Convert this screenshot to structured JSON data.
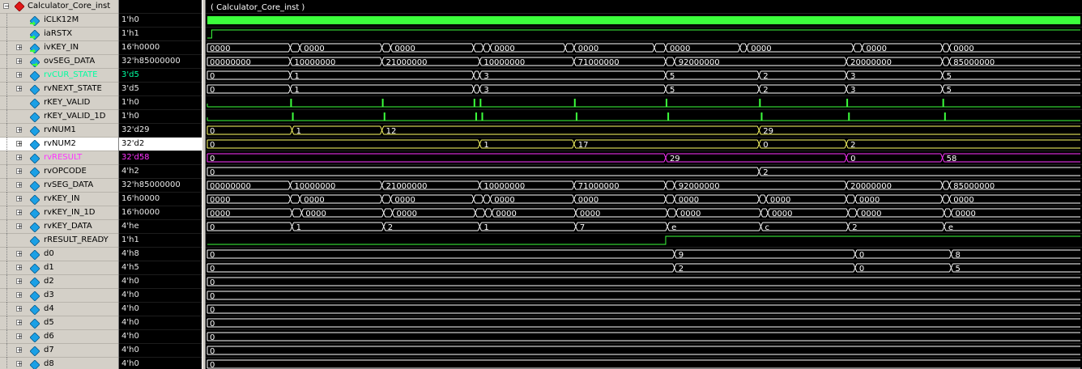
{
  "root": {
    "name": "Calculator_Core_inst",
    "wave_label": "( Calculator_Core_inst )"
  },
  "signals": [
    {
      "id": "iCLK12M",
      "name": "iCLK12M",
      "value": "1'h0",
      "kind": "clock",
      "color": "#3cff3c",
      "expandable": false,
      "icon": "input-icon"
    },
    {
      "id": "iaRSTX",
      "name": "iaRSTX",
      "value": "1'h1",
      "kind": "bit",
      "color": "#3cff3c",
      "expandable": false,
      "icon": "input-icon",
      "transitions": [
        [
          0.005,
          1
        ]
      ]
    },
    {
      "id": "ivKEY_IN",
      "name": "ivKEY_IN",
      "value": "16'h0000",
      "kind": "bus",
      "color": "#ffffff",
      "expandable": true,
      "icon": "input-icon",
      "segments": [
        [
          0,
          "0000"
        ],
        [
          0.095,
          ""
        ],
        [
          0.106,
          "0000"
        ],
        [
          0.2,
          ""
        ],
        [
          0.21,
          "0000"
        ],
        [
          0.305,
          ""
        ],
        [
          0.316,
          ""
        ],
        [
          0.324,
          "0000"
        ],
        [
          0.41,
          ""
        ],
        [
          0.42,
          "0000"
        ],
        [
          0.512,
          ""
        ],
        [
          0.525,
          "0000"
        ],
        [
          0.61,
          ""
        ],
        [
          0.618,
          "0000"
        ],
        [
          0.74,
          ""
        ],
        [
          0.75,
          "0000"
        ],
        [
          0.842,
          ""
        ],
        [
          0.85,
          "0000"
        ]
      ]
    },
    {
      "id": "ovSEG_DATA",
      "name": "ovSEG_DATA",
      "value": "32'h85000000",
      "kind": "bus",
      "color": "#ffffff",
      "expandable": true,
      "icon": "output-icon",
      "segments": [
        [
          0,
          "00000000"
        ],
        [
          0.095,
          "10000000"
        ],
        [
          0.2,
          "21000000"
        ],
        [
          0.312,
          "10000000"
        ],
        [
          0.42,
          "71000000"
        ],
        [
          0.525,
          ""
        ],
        [
          0.535,
          "92000000"
        ],
        [
          0.732,
          "20000000"
        ],
        [
          0.842,
          ""
        ],
        [
          0.85,
          "85000000"
        ]
      ]
    },
    {
      "id": "rvCUR_STATE",
      "name": "rvCUR_STATE",
      "value": "3'd5",
      "kind": "bus",
      "color": "#ffffff",
      "expandable": true,
      "icon": "reg-icon",
      "label_color": "#00ffa0",
      "segments": [
        [
          0,
          "0"
        ],
        [
          0.095,
          "1"
        ],
        [
          0.305,
          ""
        ],
        [
          0.312,
          "3"
        ],
        [
          0.525,
          "5"
        ],
        [
          0.632,
          "2"
        ],
        [
          0.732,
          "3"
        ],
        [
          0.842,
          "5"
        ]
      ]
    },
    {
      "id": "rvNEXT_STATE",
      "name": "rvNEXT_STATE",
      "value": "3'd5",
      "kind": "bus",
      "color": "#ffffff",
      "expandable": true,
      "icon": "reg-icon",
      "segments": [
        [
          0,
          "0"
        ],
        [
          0.095,
          "1"
        ],
        [
          0.305,
          ""
        ],
        [
          0.312,
          "3"
        ],
        [
          0.525,
          "5"
        ],
        [
          0.632,
          "2"
        ],
        [
          0.732,
          "3"
        ],
        [
          0.842,
          "5"
        ]
      ]
    },
    {
      "id": "rKEY_VALID",
      "name": "rKEY_VALID",
      "value": "1'h0",
      "kind": "pulses",
      "color": "#3cff3c",
      "expandable": false,
      "icon": "reg-icon",
      "pulses": [
        0.095,
        0.2,
        0.305,
        0.312,
        0.42,
        0.525,
        0.632,
        0.732,
        0.842
      ]
    },
    {
      "id": "rKEY_VALID_1D",
      "name": "rKEY_VALID_1D",
      "value": "1'h0",
      "kind": "pulses",
      "color": "#3cff3c",
      "expandable": false,
      "icon": "reg-icon",
      "pulses": [
        0.097,
        0.202,
        0.307,
        0.314,
        0.422,
        0.527,
        0.634,
        0.734,
        0.844
      ]
    },
    {
      "id": "rvNUM1",
      "name": "rvNUM1",
      "value": "32'd29",
      "kind": "bus",
      "color": "#ffff66",
      "expandable": true,
      "icon": "reg-icon",
      "segments": [
        [
          0,
          "0"
        ],
        [
          0.097,
          "1"
        ],
        [
          0.2,
          "12"
        ],
        [
          0.632,
          "29"
        ]
      ]
    },
    {
      "id": "rvNUM2",
      "name": "rvNUM2",
      "value": "32'd2",
      "kind": "bus",
      "color": "#ffff66",
      "expandable": true,
      "icon": "reg-icon",
      "selected": true,
      "segments": [
        [
          0,
          "0"
        ],
        [
          0.312,
          "1"
        ],
        [
          0.42,
          "17"
        ],
        [
          0.632,
          "0"
        ],
        [
          0.732,
          "2"
        ]
      ]
    },
    {
      "id": "rvRESULT",
      "name": "rvRESULT",
      "value": "32'd58",
      "kind": "bus",
      "color": "#ff33ff",
      "expandable": true,
      "icon": "reg-icon",
      "label_color": "#ff33ff",
      "segments": [
        [
          0,
          "0"
        ],
        [
          0.525,
          "29"
        ],
        [
          0.732,
          "0"
        ],
        [
          0.842,
          "58"
        ]
      ]
    },
    {
      "id": "rvOPCODE",
      "name": "rvOPCODE",
      "value": "4'h2",
      "kind": "bus",
      "color": "#ffffff",
      "expandable": true,
      "icon": "reg-icon",
      "segments": [
        [
          0,
          "0"
        ],
        [
          0.632,
          "2"
        ]
      ]
    },
    {
      "id": "rvSEG_DATA",
      "name": "rvSEG_DATA",
      "value": "32'h85000000",
      "kind": "bus",
      "color": "#ffffff",
      "expandable": true,
      "icon": "reg-icon",
      "segments": [
        [
          0,
          "00000000"
        ],
        [
          0.095,
          "10000000"
        ],
        [
          0.2,
          "21000000"
        ],
        [
          0.312,
          "10000000"
        ],
        [
          0.42,
          "71000000"
        ],
        [
          0.525,
          ""
        ],
        [
          0.535,
          "92000000"
        ],
        [
          0.732,
          "20000000"
        ],
        [
          0.842,
          ""
        ],
        [
          0.85,
          "85000000"
        ]
      ]
    },
    {
      "id": "rvKEY_IN",
      "name": "rvKEY_IN",
      "value": "16'h0000",
      "kind": "bus",
      "color": "#ffffff",
      "expandable": true,
      "icon": "reg-icon",
      "segments": [
        [
          0,
          "0000"
        ],
        [
          0.095,
          ""
        ],
        [
          0.106,
          "0000"
        ],
        [
          0.2,
          ""
        ],
        [
          0.21,
          "0000"
        ],
        [
          0.305,
          ""
        ],
        [
          0.316,
          ""
        ],
        [
          0.324,
          "0000"
        ],
        [
          0.42,
          "0000"
        ],
        [
          0.525,
          ""
        ],
        [
          0.535,
          "0000"
        ],
        [
          0.632,
          ""
        ],
        [
          0.64,
          "0000"
        ],
        [
          0.732,
          ""
        ],
        [
          0.742,
          "0000"
        ],
        [
          0.842,
          ""
        ],
        [
          0.85,
          "0000"
        ]
      ]
    },
    {
      "id": "rvKEY_IN_1D",
      "name": "rvKEY_IN_1D",
      "value": "16'h0000",
      "kind": "bus",
      "color": "#ffffff",
      "expandable": true,
      "icon": "reg-icon",
      "segments": [
        [
          0,
          "0000"
        ],
        [
          0.097,
          ""
        ],
        [
          0.108,
          "0000"
        ],
        [
          0.202,
          ""
        ],
        [
          0.212,
          "0000"
        ],
        [
          0.307,
          ""
        ],
        [
          0.318,
          ""
        ],
        [
          0.326,
          "0000"
        ],
        [
          0.422,
          "0000"
        ],
        [
          0.527,
          ""
        ],
        [
          0.537,
          "0000"
        ],
        [
          0.634,
          ""
        ],
        [
          0.642,
          "0000"
        ],
        [
          0.734,
          ""
        ],
        [
          0.744,
          "0000"
        ],
        [
          0.844,
          ""
        ],
        [
          0.852,
          "0000"
        ]
      ]
    },
    {
      "id": "rvKEY_DATA",
      "name": "rvKEY_DATA",
      "value": "4'he",
      "kind": "bus",
      "color": "#ffffff",
      "expandable": true,
      "icon": "reg-icon",
      "segments": [
        [
          0,
          "0"
        ],
        [
          0.097,
          "1"
        ],
        [
          0.202,
          "2"
        ],
        [
          0.312,
          "1"
        ],
        [
          0.422,
          "7"
        ],
        [
          0.527,
          "e"
        ],
        [
          0.634,
          "c"
        ],
        [
          0.734,
          "2"
        ],
        [
          0.844,
          "e"
        ]
      ]
    },
    {
      "id": "rRESULT_READY",
      "name": "rRESULT_READY",
      "value": "1'h1",
      "kind": "bit",
      "color": "#3cff3c",
      "expandable": false,
      "icon": "reg-icon",
      "transitions": [
        [
          0,
          0
        ],
        [
          0.525,
          1
        ]
      ]
    },
    {
      "id": "d0",
      "name": "d0",
      "value": "4'h8",
      "kind": "bus",
      "color": "#ffffff",
      "expandable": true,
      "icon": "wire-icon",
      "segments": [
        [
          0,
          "0"
        ],
        [
          0.535,
          "9"
        ],
        [
          0.742,
          "0"
        ],
        [
          0.852,
          "8"
        ]
      ]
    },
    {
      "id": "d1",
      "name": "d1",
      "value": "4'h5",
      "kind": "bus",
      "color": "#ffffff",
      "expandable": true,
      "icon": "wire-icon",
      "segments": [
        [
          0,
          "0"
        ],
        [
          0.535,
          "2"
        ],
        [
          0.742,
          "0"
        ],
        [
          0.852,
          "5"
        ]
      ]
    },
    {
      "id": "d2",
      "name": "d2",
      "value": "4'h0",
      "kind": "bus",
      "color": "#ffffff",
      "expandable": true,
      "icon": "wire-icon",
      "segments": [
        [
          0,
          "0"
        ]
      ]
    },
    {
      "id": "d3",
      "name": "d3",
      "value": "4'h0",
      "kind": "bus",
      "color": "#ffffff",
      "expandable": true,
      "icon": "wire-icon",
      "segments": [
        [
          0,
          "0"
        ]
      ]
    },
    {
      "id": "d4",
      "name": "d4",
      "value": "4'h0",
      "kind": "bus",
      "color": "#ffffff",
      "expandable": true,
      "icon": "wire-icon",
      "segments": [
        [
          0,
          "0"
        ]
      ]
    },
    {
      "id": "d5",
      "name": "d5",
      "value": "4'h0",
      "kind": "bus",
      "color": "#ffffff",
      "expandable": true,
      "icon": "wire-icon",
      "segments": [
        [
          0,
          "0"
        ]
      ]
    },
    {
      "id": "d6",
      "name": "d6",
      "value": "4'h0",
      "kind": "bus",
      "color": "#ffffff",
      "expandable": true,
      "icon": "wire-icon",
      "segments": [
        [
          0,
          "0"
        ]
      ]
    },
    {
      "id": "d7",
      "name": "d7",
      "value": "4'h0",
      "kind": "bus",
      "color": "#ffffff",
      "expandable": true,
      "icon": "wire-icon",
      "segments": [
        [
          0,
          "0"
        ]
      ]
    },
    {
      "id": "d8",
      "name": "d8",
      "value": "4'h0",
      "kind": "bus",
      "color": "#ffffff",
      "expandable": true,
      "icon": "wire-icon",
      "segments": [
        [
          0,
          "0"
        ]
      ]
    }
  ],
  "colors": {
    "pane_bg": "#d4d0c8",
    "wave_bg": "#000000",
    "clock": "#3cff3c",
    "selection": "#ffffff"
  }
}
